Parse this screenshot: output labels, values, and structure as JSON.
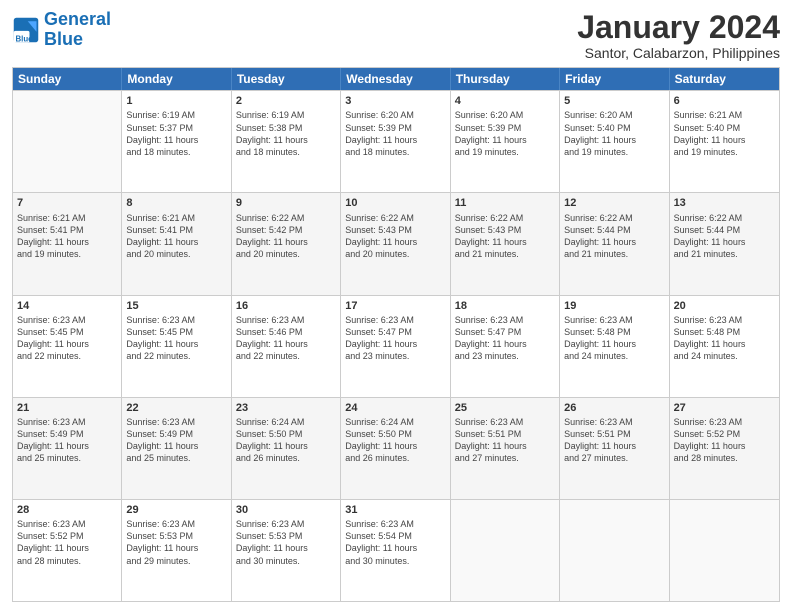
{
  "logo": {
    "text_general": "General",
    "text_blue": "Blue"
  },
  "title": "January 2024",
  "subtitle": "Santor, Calabarzon, Philippines",
  "days_of_week": [
    "Sunday",
    "Monday",
    "Tuesday",
    "Wednesday",
    "Thursday",
    "Friday",
    "Saturday"
  ],
  "weeks": [
    [
      {
        "day": "",
        "lines": []
      },
      {
        "day": "1",
        "lines": [
          "Sunrise: 6:19 AM",
          "Sunset: 5:37 PM",
          "Daylight: 11 hours",
          "and 18 minutes."
        ]
      },
      {
        "day": "2",
        "lines": [
          "Sunrise: 6:19 AM",
          "Sunset: 5:38 PM",
          "Daylight: 11 hours",
          "and 18 minutes."
        ]
      },
      {
        "day": "3",
        "lines": [
          "Sunrise: 6:20 AM",
          "Sunset: 5:39 PM",
          "Daylight: 11 hours",
          "and 18 minutes."
        ]
      },
      {
        "day": "4",
        "lines": [
          "Sunrise: 6:20 AM",
          "Sunset: 5:39 PM",
          "Daylight: 11 hours",
          "and 19 minutes."
        ]
      },
      {
        "day": "5",
        "lines": [
          "Sunrise: 6:20 AM",
          "Sunset: 5:40 PM",
          "Daylight: 11 hours",
          "and 19 minutes."
        ]
      },
      {
        "day": "6",
        "lines": [
          "Sunrise: 6:21 AM",
          "Sunset: 5:40 PM",
          "Daylight: 11 hours",
          "and 19 minutes."
        ]
      }
    ],
    [
      {
        "day": "7",
        "lines": [
          "Sunrise: 6:21 AM",
          "Sunset: 5:41 PM",
          "Daylight: 11 hours",
          "and 19 minutes."
        ]
      },
      {
        "day": "8",
        "lines": [
          "Sunrise: 6:21 AM",
          "Sunset: 5:41 PM",
          "Daylight: 11 hours",
          "and 20 minutes."
        ]
      },
      {
        "day": "9",
        "lines": [
          "Sunrise: 6:22 AM",
          "Sunset: 5:42 PM",
          "Daylight: 11 hours",
          "and 20 minutes."
        ]
      },
      {
        "day": "10",
        "lines": [
          "Sunrise: 6:22 AM",
          "Sunset: 5:43 PM",
          "Daylight: 11 hours",
          "and 20 minutes."
        ]
      },
      {
        "day": "11",
        "lines": [
          "Sunrise: 6:22 AM",
          "Sunset: 5:43 PM",
          "Daylight: 11 hours",
          "and 21 minutes."
        ]
      },
      {
        "day": "12",
        "lines": [
          "Sunrise: 6:22 AM",
          "Sunset: 5:44 PM",
          "Daylight: 11 hours",
          "and 21 minutes."
        ]
      },
      {
        "day": "13",
        "lines": [
          "Sunrise: 6:22 AM",
          "Sunset: 5:44 PM",
          "Daylight: 11 hours",
          "and 21 minutes."
        ]
      }
    ],
    [
      {
        "day": "14",
        "lines": [
          "Sunrise: 6:23 AM",
          "Sunset: 5:45 PM",
          "Daylight: 11 hours",
          "and 22 minutes."
        ]
      },
      {
        "day": "15",
        "lines": [
          "Sunrise: 6:23 AM",
          "Sunset: 5:45 PM",
          "Daylight: 11 hours",
          "and 22 minutes."
        ]
      },
      {
        "day": "16",
        "lines": [
          "Sunrise: 6:23 AM",
          "Sunset: 5:46 PM",
          "Daylight: 11 hours",
          "and 22 minutes."
        ]
      },
      {
        "day": "17",
        "lines": [
          "Sunrise: 6:23 AM",
          "Sunset: 5:47 PM",
          "Daylight: 11 hours",
          "and 23 minutes."
        ]
      },
      {
        "day": "18",
        "lines": [
          "Sunrise: 6:23 AM",
          "Sunset: 5:47 PM",
          "Daylight: 11 hours",
          "and 23 minutes."
        ]
      },
      {
        "day": "19",
        "lines": [
          "Sunrise: 6:23 AM",
          "Sunset: 5:48 PM",
          "Daylight: 11 hours",
          "and 24 minutes."
        ]
      },
      {
        "day": "20",
        "lines": [
          "Sunrise: 6:23 AM",
          "Sunset: 5:48 PM",
          "Daylight: 11 hours",
          "and 24 minutes."
        ]
      }
    ],
    [
      {
        "day": "21",
        "lines": [
          "Sunrise: 6:23 AM",
          "Sunset: 5:49 PM",
          "Daylight: 11 hours",
          "and 25 minutes."
        ]
      },
      {
        "day": "22",
        "lines": [
          "Sunrise: 6:23 AM",
          "Sunset: 5:49 PM",
          "Daylight: 11 hours",
          "and 25 minutes."
        ]
      },
      {
        "day": "23",
        "lines": [
          "Sunrise: 6:24 AM",
          "Sunset: 5:50 PM",
          "Daylight: 11 hours",
          "and 26 minutes."
        ]
      },
      {
        "day": "24",
        "lines": [
          "Sunrise: 6:24 AM",
          "Sunset: 5:50 PM",
          "Daylight: 11 hours",
          "and 26 minutes."
        ]
      },
      {
        "day": "25",
        "lines": [
          "Sunrise: 6:23 AM",
          "Sunset: 5:51 PM",
          "Daylight: 11 hours",
          "and 27 minutes."
        ]
      },
      {
        "day": "26",
        "lines": [
          "Sunrise: 6:23 AM",
          "Sunset: 5:51 PM",
          "Daylight: 11 hours",
          "and 27 minutes."
        ]
      },
      {
        "day": "27",
        "lines": [
          "Sunrise: 6:23 AM",
          "Sunset: 5:52 PM",
          "Daylight: 11 hours",
          "and 28 minutes."
        ]
      }
    ],
    [
      {
        "day": "28",
        "lines": [
          "Sunrise: 6:23 AM",
          "Sunset: 5:52 PM",
          "Daylight: 11 hours",
          "and 28 minutes."
        ]
      },
      {
        "day": "29",
        "lines": [
          "Sunrise: 6:23 AM",
          "Sunset: 5:53 PM",
          "Daylight: 11 hours",
          "and 29 minutes."
        ]
      },
      {
        "day": "30",
        "lines": [
          "Sunrise: 6:23 AM",
          "Sunset: 5:53 PM",
          "Daylight: 11 hours",
          "and 30 minutes."
        ]
      },
      {
        "day": "31",
        "lines": [
          "Sunrise: 6:23 AM",
          "Sunset: 5:54 PM",
          "Daylight: 11 hours",
          "and 30 minutes."
        ]
      },
      {
        "day": "",
        "lines": []
      },
      {
        "day": "",
        "lines": []
      },
      {
        "day": "",
        "lines": []
      }
    ]
  ]
}
